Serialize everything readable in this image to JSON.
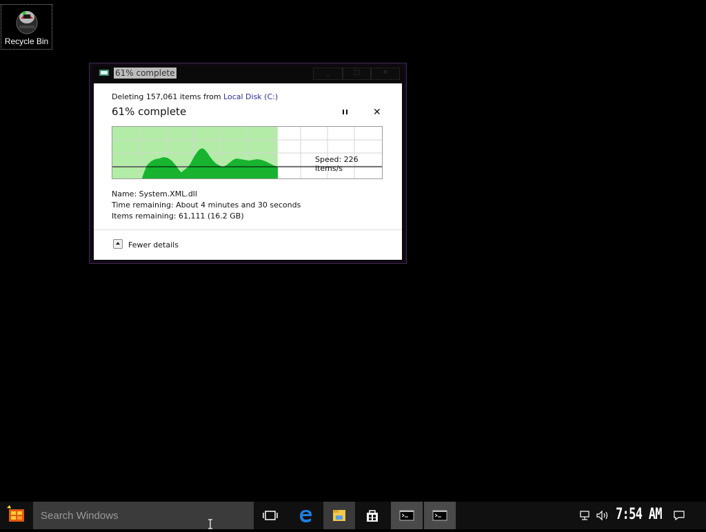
{
  "desktop": {
    "recycle_bin_label": "Recycle Bin"
  },
  "dialog": {
    "title": "61% complete",
    "line1_prefix": "Deleting 157,061 items from ",
    "line1_link": "Local Disk (C:)",
    "progress_text": "61% complete",
    "progress_percent": 61,
    "speed_text": "Speed: 226 items/s",
    "name_line": "Name:  System.XML.dll",
    "time_line": "Time remaining:  About 4 minutes and 30 seconds",
    "items_line": "Items remaining:  61,111 (16.2 GB)",
    "fewer_details_label": "Fewer details"
  },
  "taskbar": {
    "search_placeholder": "Search Windows",
    "clock": "7:54 AM"
  },
  "colors": {
    "progress_fill": "#b2eca6",
    "graph_fill": "#18b430",
    "taskbar_bg": "#101010",
    "search_bg": "#3b3b3b"
  }
}
